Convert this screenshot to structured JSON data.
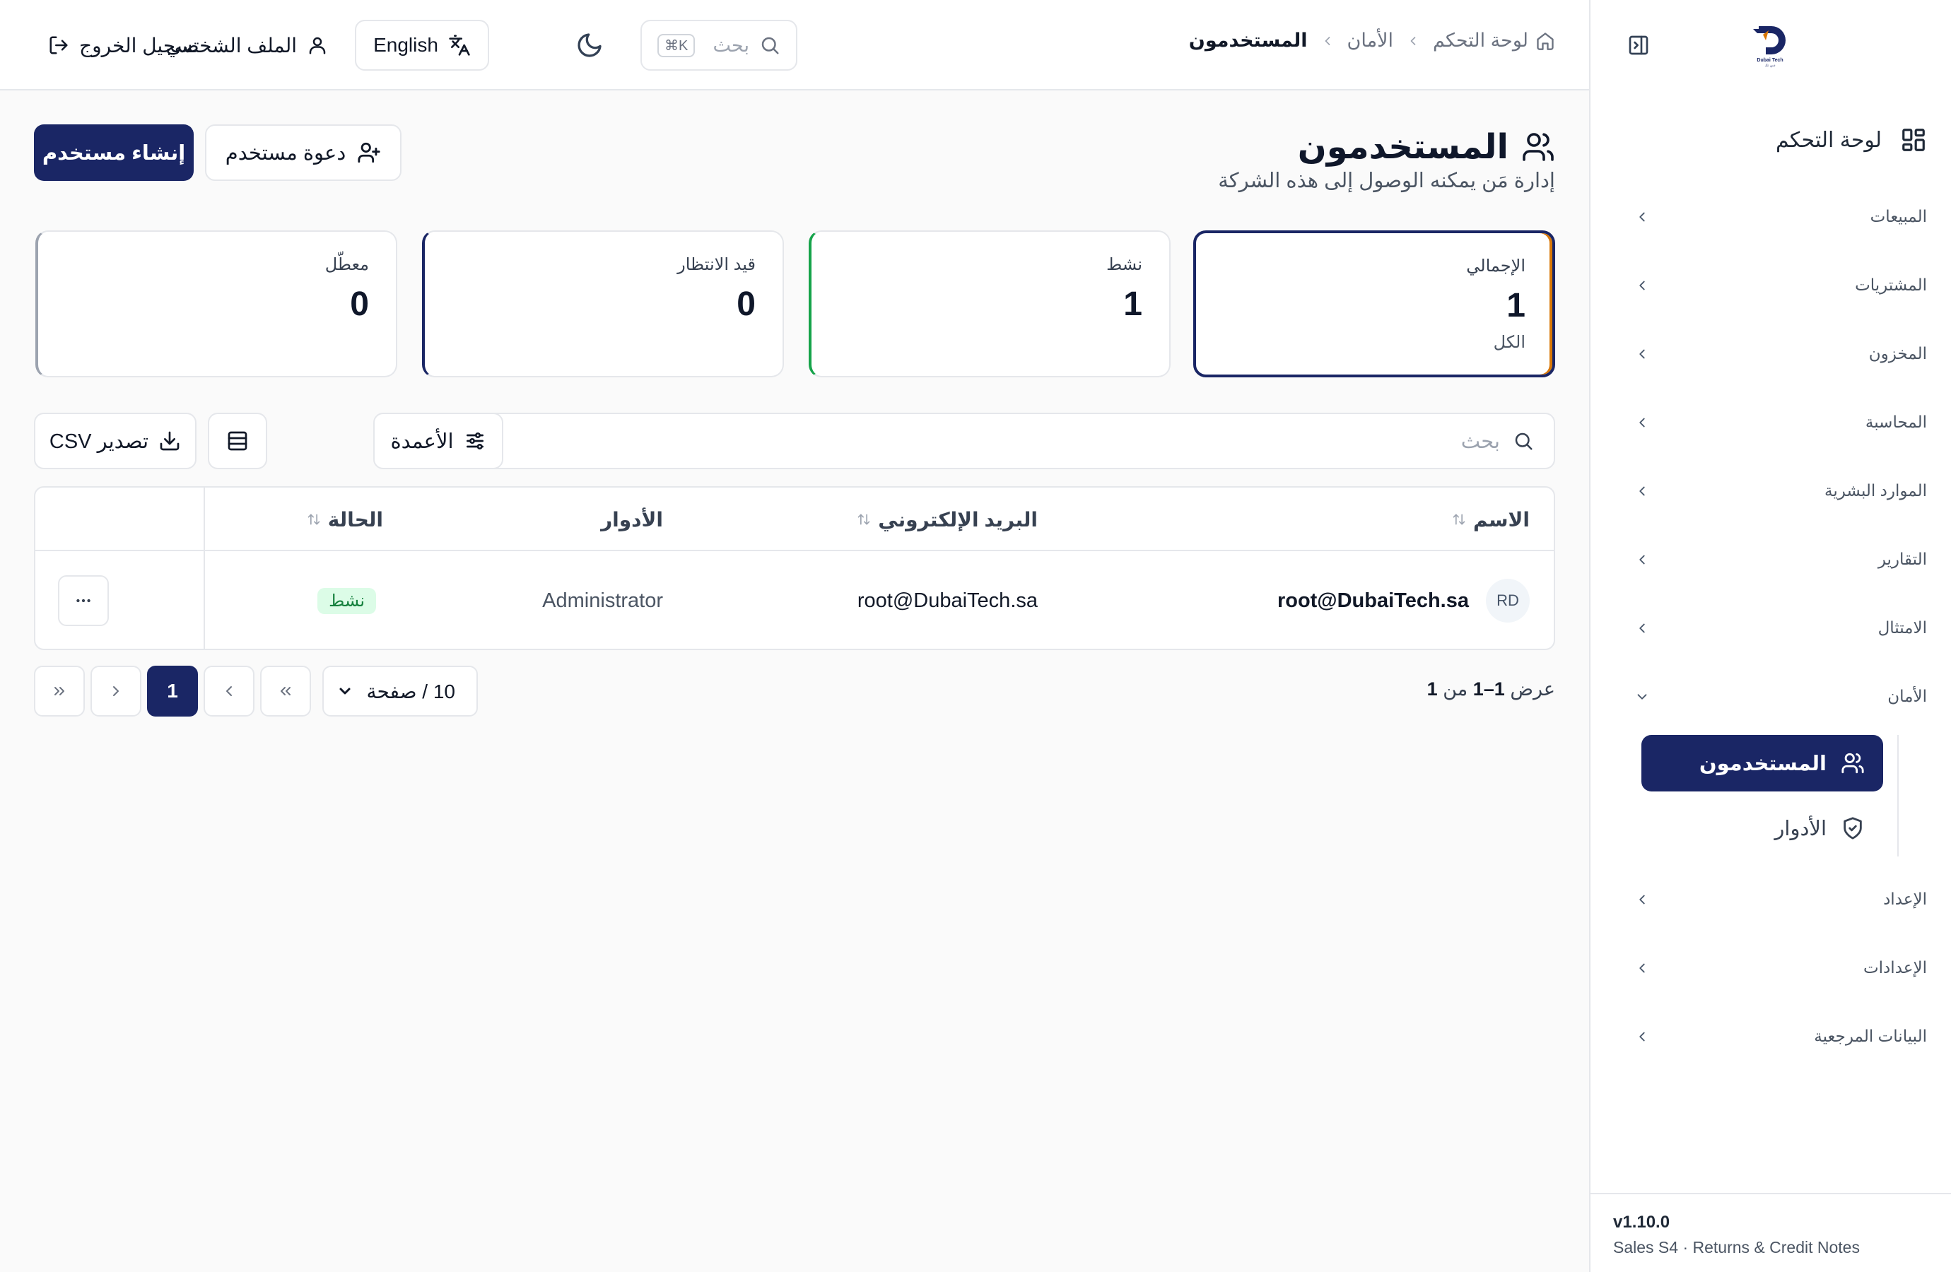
{
  "app": {
    "brand": "Dubai Tech"
  },
  "sidebar": {
    "dashboard": "لوحة التحكم",
    "items": [
      {
        "label": "المبيعات"
      },
      {
        "label": "المشتريات"
      },
      {
        "label": "المخزون"
      },
      {
        "label": "المحاسبة"
      },
      {
        "label": "الموارد البشرية"
      },
      {
        "label": "التقارير"
      },
      {
        "label": "الامتثال"
      },
      {
        "label": "الأمان"
      }
    ],
    "security_sub": [
      {
        "label": "المستخدمون",
        "active": true
      },
      {
        "label": "الأدوار",
        "active": false
      }
    ],
    "items_after": [
      {
        "label": "الإعداد"
      },
      {
        "label": "الإعدادات"
      },
      {
        "label": "البيانات المرجعية"
      }
    ],
    "version": "v1.10.0",
    "build": "Sales S4 · Returns & Credit Notes"
  },
  "header": {
    "breadcrumb": [
      "لوحة التحكم",
      "الأمان",
      "المستخدمون"
    ],
    "search_placeholder": "بحث",
    "search_shortcut": "⌘K",
    "language_label": "English",
    "profile_label": "الملف الشخصي",
    "logout_label": "تسجيل الخروج"
  },
  "page": {
    "title": "المستخدمون",
    "subtitle": "إدارة مَن يمكنه الوصول إلى هذه الشركة",
    "invite_label": "دعوة مستخدم",
    "create_label": "إنشاء مستخدم"
  },
  "stats": {
    "total": {
      "label": "الإجمالي",
      "value": "1",
      "note": "الكل"
    },
    "active": {
      "label": "نشط",
      "value": "1"
    },
    "pending": {
      "label": "قيد الانتظار",
      "value": "0"
    },
    "disabled": {
      "label": "معطّل",
      "value": "0"
    }
  },
  "toolbar": {
    "search_placeholder": "بحث",
    "columns_label": "الأعمدة",
    "export_label": "تصدير CSV"
  },
  "table": {
    "headers": {
      "name": "الاسم",
      "email": "البريد الإلكتروني",
      "roles": "الأدوار",
      "status": "الحالة"
    },
    "rows": [
      {
        "initials": "RD",
        "name": "root@DubaiTech.sa",
        "email": "root@DubaiTech.sa",
        "roles": "Administrator",
        "status": "نشط"
      }
    ]
  },
  "pagination": {
    "prefix": "عرض",
    "range": "1–1",
    "of": "من",
    "total": "1",
    "page_size": "10 / صفحة",
    "current_page": "1"
  },
  "colors": {
    "primary": "#1a2665",
    "success": "#16a34a",
    "accent": "#d97706"
  }
}
